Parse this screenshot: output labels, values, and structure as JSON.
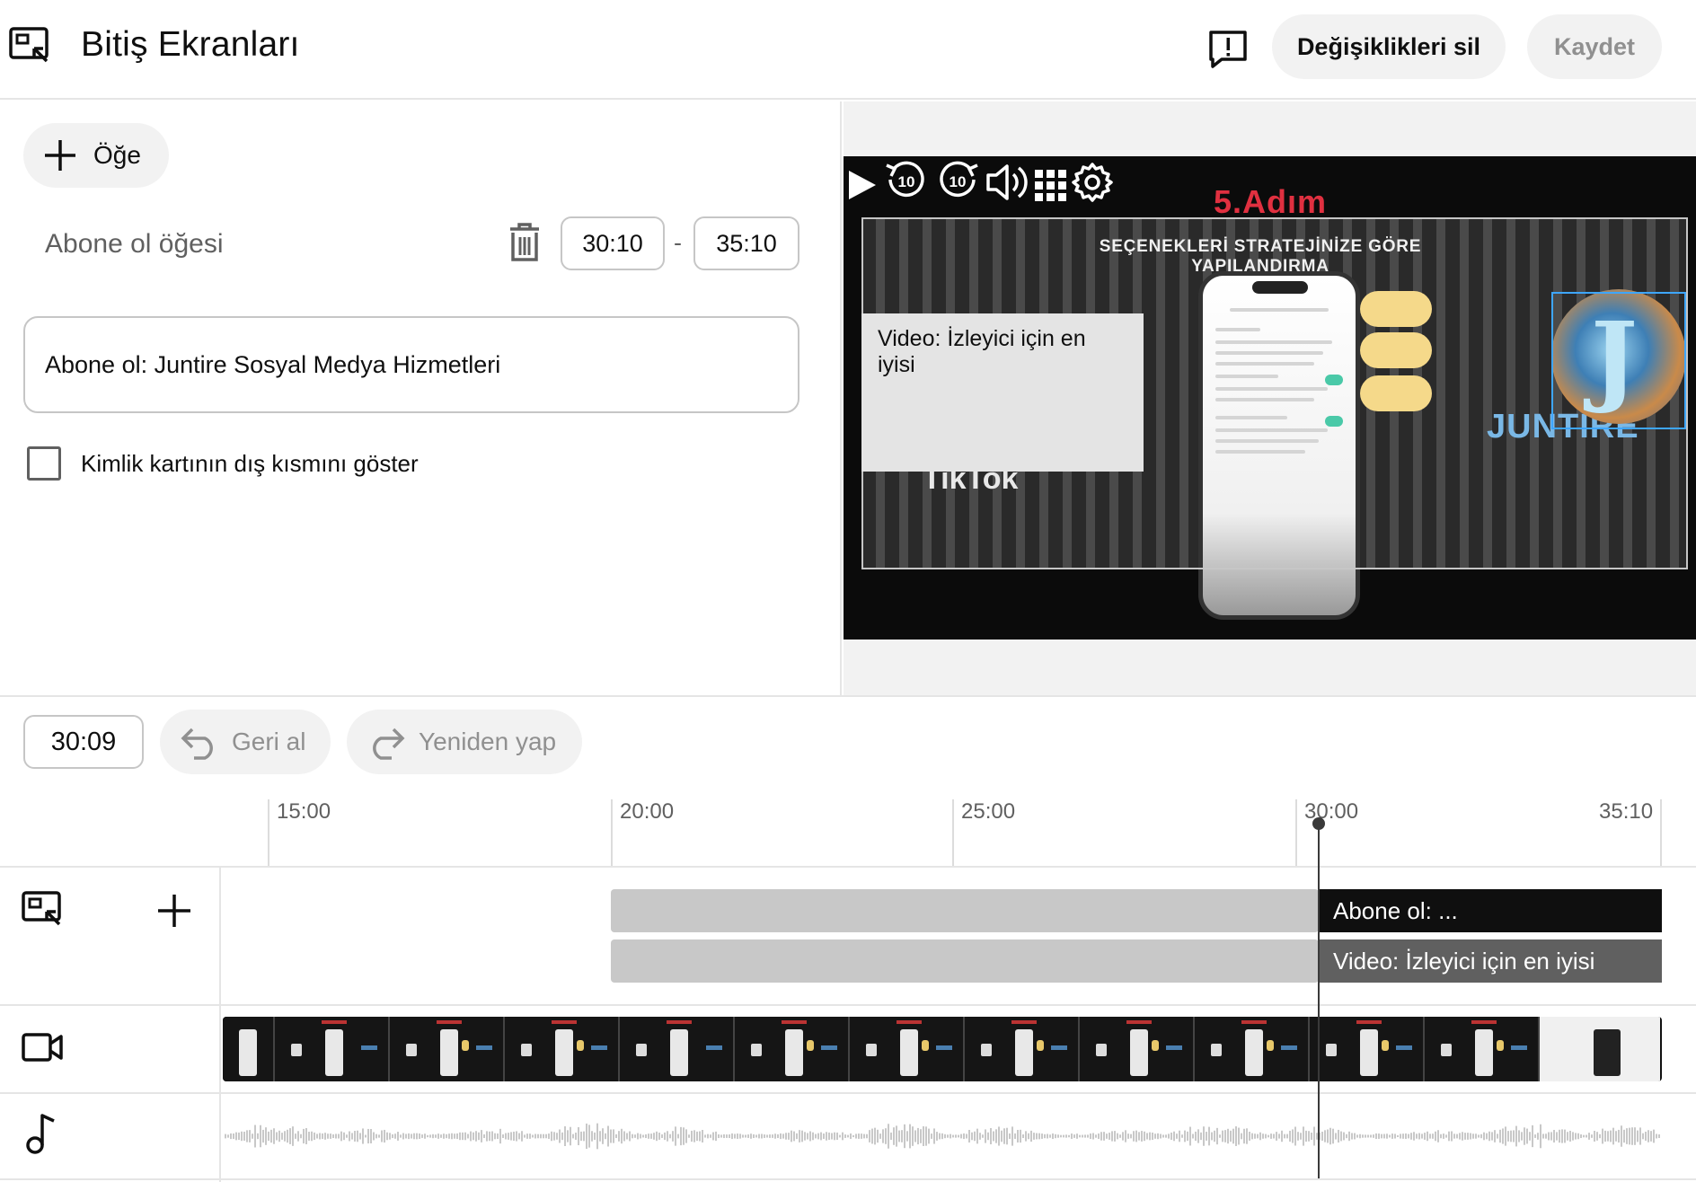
{
  "header": {
    "title": "Bitiş Ekranları",
    "title_icon": "end-screen-icon",
    "feedback_icon": "feedback-icon",
    "discard_label": "Değişiklikleri sil",
    "save_label": "Kaydet"
  },
  "editor": {
    "add_element_label": "Öğe",
    "element_label": "Abone ol öğesi",
    "start_time": "30:10",
    "time_separator": "-",
    "end_time": "35:10",
    "channel_value": "Abone ol: Juntire Sosyal Medya Hizmetleri",
    "checkbox_label": "Kimlik kartının dış kısmını göster",
    "checkbox_checked": false
  },
  "preview": {
    "slide_title": "5.Adım",
    "slide_subtitle": "SEÇENEKLERİ STRATEJİNİZE GÖRE YAPILANDIRMA",
    "tiktok_word": "TikTok",
    "brand_word": "JUNTIRE",
    "logo_letter": "J",
    "video_element_label": "Video: İzleyici için en iyisi",
    "controls": [
      "play-icon",
      "rewind-10-icon",
      "forward-10-icon",
      "volume-icon",
      "grid-icon",
      "settings-icon"
    ],
    "skip_seconds": "10"
  },
  "timeline": {
    "current_time": "30:09",
    "undo_label": "Geri al",
    "redo_label": "Yeniden yap",
    "ticks": [
      "15:00",
      "20:00",
      "25:00",
      "30:00",
      "35:10"
    ],
    "tracks": {
      "element_bar_1_label": "Abone ol: ...",
      "element_bar_2_label": "Video: İzleyici için en iyisi"
    },
    "track_icons": [
      "end-screen-icon",
      "plus-icon",
      "video-camera-icon",
      "music-note-icon"
    ]
  },
  "colors": {
    "accent_blue": "#3ea6ff",
    "pill_bg": "#f2f2f2",
    "bar_gray": "#c8c8c8",
    "bar_black": "#0f0f0f"
  }
}
